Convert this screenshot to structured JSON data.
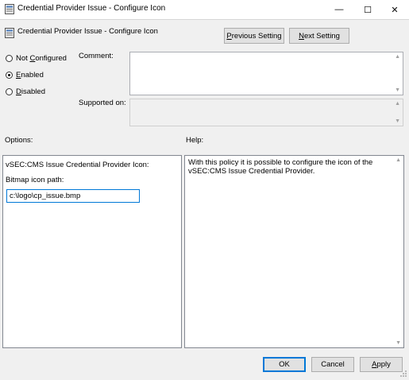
{
  "window": {
    "title": "Credential Provider Issue - Configure Icon",
    "minimize_glyph": "—",
    "maximize_glyph": "☐",
    "close_glyph": "✕"
  },
  "header": {
    "policy_name": "Credential Provider Issue - Configure Icon",
    "prev_label_u": "P",
    "prev_label_rest": "revious Setting",
    "next_label_u": "N",
    "next_label_rest": "ext Setting"
  },
  "state": {
    "not_configured_u": "C",
    "not_configured_pre": "Not ",
    "not_configured_post": "onfigured",
    "enabled_u": "E",
    "enabled_rest": "nabled",
    "disabled_u": "D",
    "disabled_rest": "isabled",
    "selected": "enabled"
  },
  "labels": {
    "comment": "Comment:",
    "supported_on": "Supported on:",
    "options": "Options:",
    "help": "Help:"
  },
  "options": {
    "heading": "vSEC:CMS Issue Credential Provider Icon:",
    "bitmap_label": "Bitmap icon path:",
    "bitmap_value": "c:\\logo\\cp_issue.bmp"
  },
  "help": {
    "line1": "With this policy it is possible to configure the icon of the",
    "line2": "vSEC:CMS Issue Credential Provider."
  },
  "footer": {
    "ok": "OK",
    "cancel": "Cancel",
    "apply_u": "A",
    "apply_rest": "pply"
  },
  "colors": {
    "accent": "#0078d7",
    "dialog_bg": "#f0f0f0"
  }
}
